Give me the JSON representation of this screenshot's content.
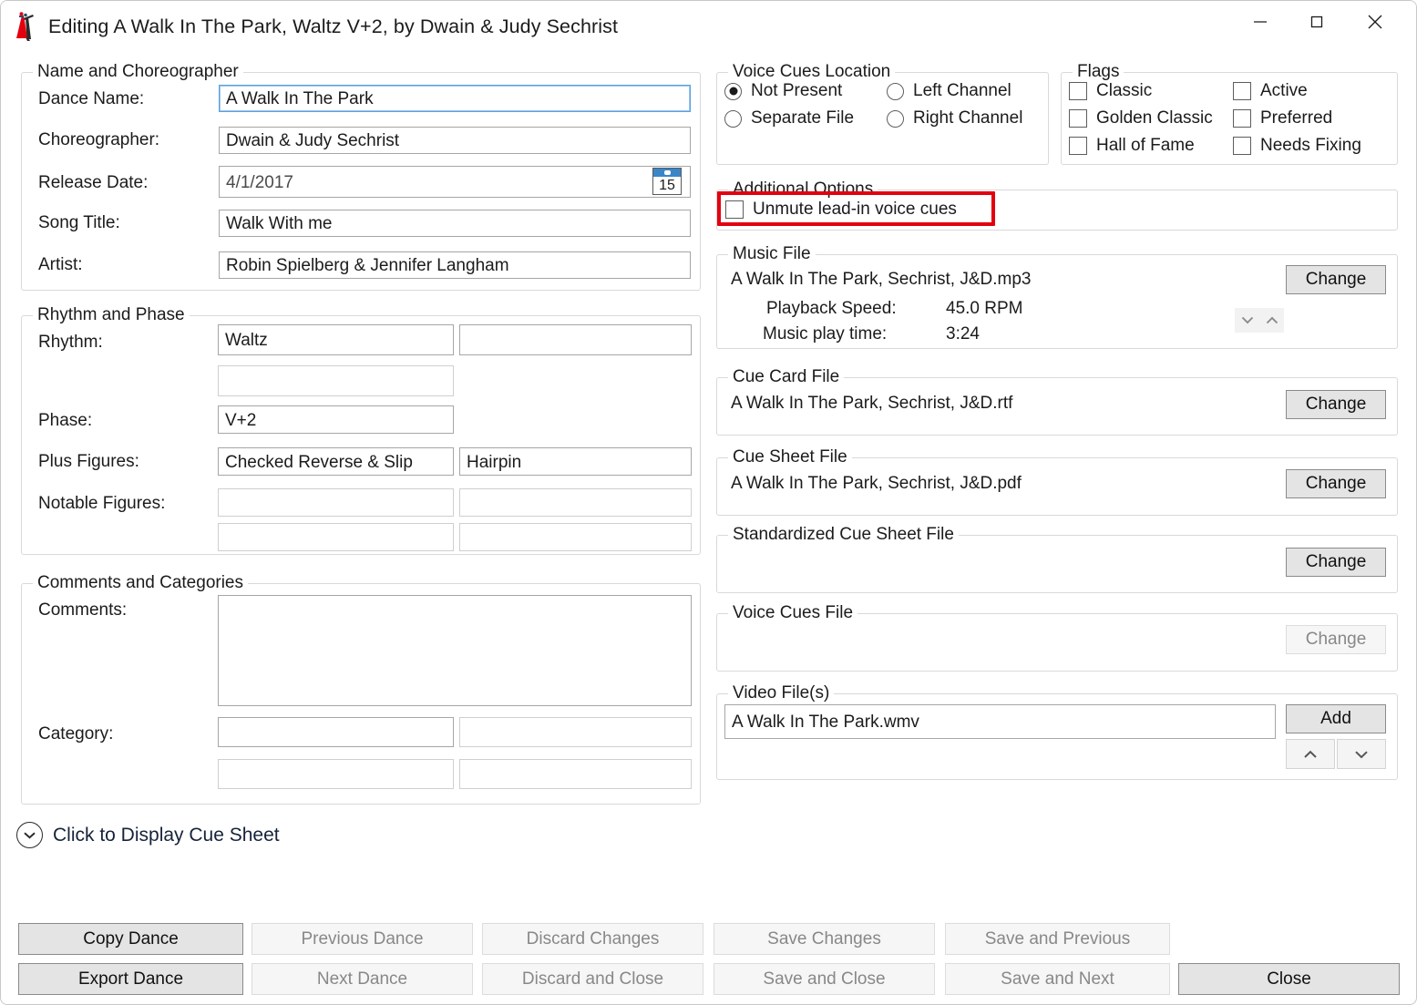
{
  "window": {
    "title": "Editing A Walk In The Park, Waltz V+2, by Dwain & Judy Sechrist",
    "app_icon": "dancing-couple-icon",
    "controls": {
      "minimize": "minimize-icon",
      "maximize": "maximize-icon",
      "close": "close-icon"
    },
    "accent_red": "#e3000f"
  },
  "name_group": {
    "legend": "Name and Choreographer",
    "fields": [
      {
        "label": "Dance Name:",
        "value": "A Walk In The Park"
      },
      {
        "label": "Choreographer:",
        "value": "Dwain & Judy Sechrist"
      },
      {
        "label": "Release Date:",
        "value": "4/1/2017",
        "icon": "calendar-icon",
        "icon_day": "15"
      },
      {
        "label": "Song Title:",
        "value": "Walk With me"
      },
      {
        "label": "Artist:",
        "value": "Robin Spielberg & Jennifer Langham"
      }
    ]
  },
  "rhythm_group": {
    "legend": "Rhythm and Phase",
    "rhythm_label": "Rhythm:",
    "rhythm_value": "Waltz",
    "rhythm_value_2": "",
    "rhythm_value_3": "",
    "phase_label": "Phase:",
    "phase_value": "V+2",
    "plus_figures_label": "Plus Figures:",
    "plus_figures_1": "Checked Reverse & Slip",
    "plus_figures_2": "Hairpin",
    "notable_figures_label": "Notable Figures:",
    "notable_figures_1": "",
    "notable_figures_2": "",
    "notable_figures_3": "",
    "notable_figures_4": ""
  },
  "comments_group": {
    "legend": "Comments and Categories",
    "comments_label": "Comments:",
    "comments_value": "",
    "category_label": "Category:",
    "category_1": "",
    "category_2": "",
    "category_3": "",
    "category_4": ""
  },
  "voice_cues_group": {
    "legend": "Voice Cues Location",
    "options": [
      {
        "label": "Not Present",
        "selected": true
      },
      {
        "label": "Left Channel",
        "selected": false
      },
      {
        "label": "Separate File",
        "selected": false
      },
      {
        "label": "Right Channel",
        "selected": false
      }
    ]
  },
  "flags_group": {
    "legend": "Flags",
    "items": [
      {
        "label": "Classic",
        "checked": false
      },
      {
        "label": "Active",
        "checked": false
      },
      {
        "label": "Golden Classic",
        "checked": false
      },
      {
        "label": "Preferred",
        "checked": false
      },
      {
        "label": "Hall of Fame",
        "checked": false
      },
      {
        "label": "Needs Fixing",
        "checked": false
      }
    ]
  },
  "additional_options_group": {
    "legend": "Additional Options",
    "unmute_label": "Unmute lead-in voice cues",
    "unmute_checked": false,
    "highlight_color": "#e3000f"
  },
  "music_file_group": {
    "legend": "Music File",
    "filename": "A Walk In The Park, Sechrist, J&D.mp3",
    "playback_speed_label": "Playback Speed:",
    "playback_speed_value": "45.0 RPM",
    "play_time_label": "Music play time:",
    "play_time_value": "3:24",
    "change_label": "Change",
    "spin_down": "chevron-down-icon",
    "spin_up": "chevron-up-icon"
  },
  "cue_card_group": {
    "legend": "Cue Card File",
    "filename": "A Walk In The Park, Sechrist, J&D.rtf",
    "change_label": "Change"
  },
  "cue_sheet_group": {
    "legend": "Cue Sheet File",
    "filename": "A Walk In The Park, Sechrist, J&D.pdf",
    "change_label": "Change"
  },
  "standardized_cue_sheet_group": {
    "legend": "Standardized Cue Sheet File",
    "filename": "",
    "change_label": "Change"
  },
  "voice_cues_file_group": {
    "legend": "Voice Cues File",
    "filename": "",
    "change_label": "Change",
    "change_disabled": true
  },
  "video_files_group": {
    "legend": "Video File(s)",
    "files": [
      "A Walk In The Park.wmv"
    ],
    "add_label": "Add",
    "move_up": "chevron-up-icon",
    "move_down": "chevron-down-icon"
  },
  "cue_sheet_toggle": {
    "label": "Click to Display Cue Sheet",
    "icon": "chevron-down-circle-icon"
  },
  "footer_buttons": [
    {
      "label": "Copy Dance",
      "enabled": true
    },
    {
      "label": "Previous Dance",
      "enabled": false
    },
    {
      "label": "Discard Changes",
      "enabled": false
    },
    {
      "label": "Save Changes",
      "enabled": false
    },
    {
      "label": "Save and Previous",
      "enabled": false
    },
    {
      "label": "Export Dance",
      "enabled": true
    },
    {
      "label": "Next Dance",
      "enabled": false
    },
    {
      "label": "Discard and Close",
      "enabled": false
    },
    {
      "label": "Save and Close",
      "enabled": false
    },
    {
      "label": "Save and Next",
      "enabled": false
    },
    {
      "label": "Close",
      "enabled": true
    }
  ]
}
